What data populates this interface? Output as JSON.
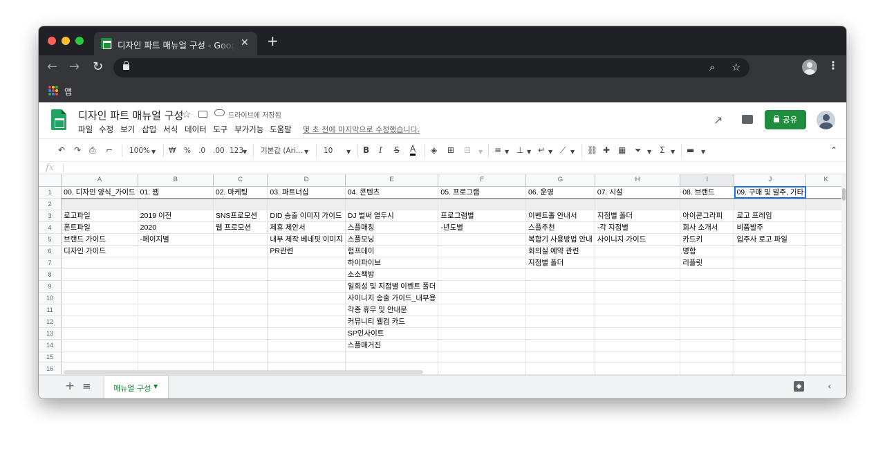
{
  "browser": {
    "tab_title": "디자인 파트 매뉴얼 구성 - Google Sheets",
    "tab_close": "✕",
    "new_tab": "+",
    "bookmark_label": "앱",
    "apps_colors": [
      "#ea4335",
      "#fbbc04",
      "#34a853",
      "#4285f4",
      "#ea4335",
      "#fbbc04",
      "#34a853",
      "#4285f4",
      "#ea4335"
    ]
  },
  "doc": {
    "title": "디자인 파트 매뉴얼 구성",
    "saved_status": "드라이브에 저장됨",
    "menus": [
      "파일",
      "수정",
      "보기",
      "삽입",
      "서식",
      "데이터",
      "도구",
      "부가기능",
      "도움말"
    ],
    "last_edit": "몇 초 전에 마지막으로 수정했습니다.",
    "share_label": "공유",
    "accent_color": "#1e8e3e"
  },
  "toolbar": {
    "zoom": "100%",
    "currency": "₩",
    "percent": "%",
    "dec_less": ".0",
    "dec_more": ".00",
    "more_formats": "123",
    "font": "기본값 (Ari...",
    "font_size": "10",
    "bold": "B",
    "italic": "I",
    "strike": "S",
    "text_color": "A"
  },
  "formula_bar": {
    "fx_label": "fx",
    "value": ""
  },
  "sheet": {
    "columns": [
      "A",
      "B",
      "C",
      "D",
      "E",
      "F",
      "G",
      "H",
      "I",
      "J",
      "K"
    ],
    "selected_column": "I",
    "rows": [
      {
        "n": "1",
        "cells": [
          "00. 디자인 양식_가이드",
          "01. 웹",
          "02. 마케팅",
          "03. 파트너십",
          "04. 콘텐츠",
          "05. 프로그램",
          "06. 운영",
          "07. 시설",
          "08. 브랜드",
          "09. 구매 및 발주, 기타",
          ""
        ]
      },
      {
        "n": "2",
        "cells": [
          "",
          "",
          "",
          "",
          "",
          "",
          "",
          "",
          "",
          "",
          ""
        ]
      },
      {
        "n": "3",
        "cells": [
          "로고파일",
          "2019 이전",
          "SNS프로모션",
          "DID 송출 이미지 가이드",
          "DJ 벌써 열두시",
          "프로그램별",
          "이벤트홀 안내서",
          "지점별 폴더",
          "아이콘그라피",
          "로고 프레임",
          ""
        ]
      },
      {
        "n": "4",
        "cells": [
          "폰트파일",
          "2020",
          "웹 프로모션",
          "제휴 제안서",
          "스플매칭",
          "-년도별",
          "스플추천",
          "-각 지점별",
          "회사 소개서",
          "비품발주",
          ""
        ]
      },
      {
        "n": "5",
        "cells": [
          "브랜드 가이드",
          "-페이지별",
          "",
          "내부 제작 베네핏 이미지",
          "스플모닝",
          "",
          "복합기 사용방법 안내",
          "사이니지 가이드",
          "카드키",
          "입주사 로고 파일",
          ""
        ]
      },
      {
        "n": "6",
        "cells": [
          "디자인 가이드",
          "",
          "",
          "PR관련",
          "험프데이",
          "",
          "회의실 예약 관련",
          "",
          "명함",
          "",
          ""
        ]
      },
      {
        "n": "7",
        "cells": [
          "",
          "",
          "",
          "",
          "하이파이브",
          "",
          "지점별 폴더",
          "",
          "리플릿",
          "",
          ""
        ]
      },
      {
        "n": "8",
        "cells": [
          "",
          "",
          "",
          "",
          "소소책방",
          "",
          "",
          "",
          "",
          "",
          ""
        ]
      },
      {
        "n": "9",
        "cells": [
          "",
          "",
          "",
          "",
          "일회성 및 지점별 이벤트 폴더",
          "",
          "",
          "",
          "",
          "",
          ""
        ]
      },
      {
        "n": "10",
        "cells": [
          "",
          "",
          "",
          "",
          "사이니지 송출 가이드_내부용",
          "",
          "",
          "",
          "",
          "",
          ""
        ]
      },
      {
        "n": "11",
        "cells": [
          "",
          "",
          "",
          "",
          "각종 휴무 및 안내문",
          "",
          "",
          "",
          "",
          "",
          ""
        ]
      },
      {
        "n": "12",
        "cells": [
          "",
          "",
          "",
          "",
          "커뮤니티 웰컴 카드",
          "",
          "",
          "",
          "",
          "",
          ""
        ]
      },
      {
        "n": "13",
        "cells": [
          "",
          "",
          "",
          "",
          "SP인사이트",
          "",
          "",
          "",
          "",
          "",
          ""
        ]
      },
      {
        "n": "14",
        "cells": [
          "",
          "",
          "",
          "",
          "스플매거진",
          "",
          "",
          "",
          "",
          "",
          ""
        ]
      },
      {
        "n": "15",
        "cells": [
          "",
          "",
          "",
          "",
          "",
          "",
          "",
          "",
          "",
          "",
          ""
        ]
      },
      {
        "n": "16",
        "cells": [
          "",
          "",
          "",
          "",
          "",
          "",
          "",
          "",
          "",
          "",
          ""
        ]
      }
    ]
  },
  "sheet_tabs": {
    "active": "매뉴얼 구성"
  }
}
